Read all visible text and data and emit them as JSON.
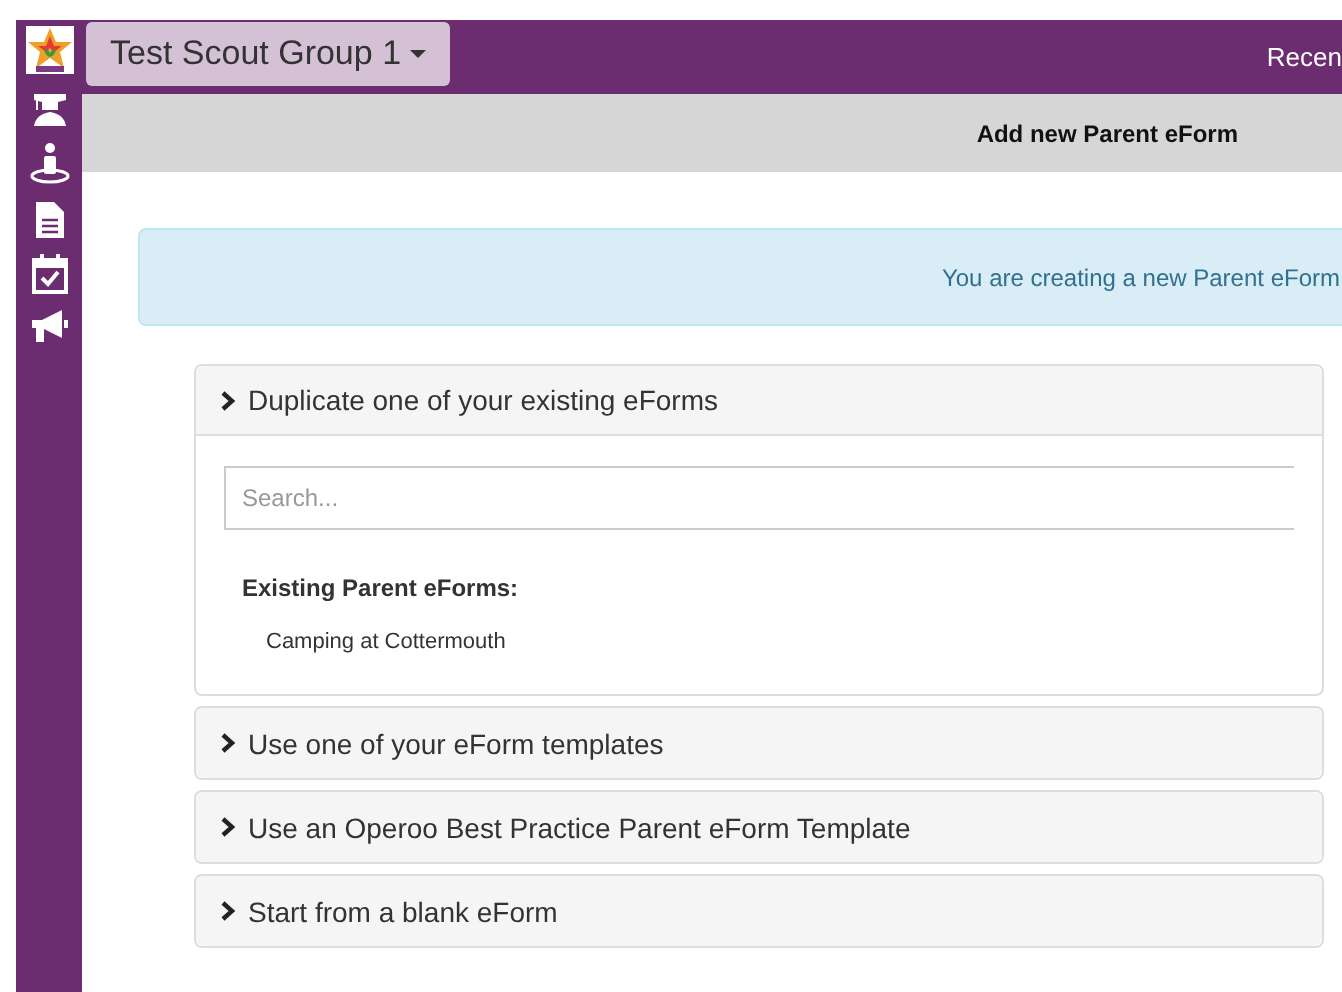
{
  "sidebar": {
    "items": [
      {
        "kind": "logo"
      },
      {
        "kind": "graduate"
      },
      {
        "kind": "person"
      },
      {
        "kind": "document"
      },
      {
        "kind": "calendar"
      },
      {
        "kind": "megaphone"
      }
    ]
  },
  "topbar": {
    "group_dropdown": "Test Scout Group 1",
    "right_link": "Recen"
  },
  "header": {
    "title": "Add new Parent eForm"
  },
  "alert": {
    "text": "You are creating a new Parent eForm"
  },
  "accordion": [
    {
      "title": "Duplicate one of your existing eForms",
      "expanded": true,
      "search": {
        "placeholder": "Search..."
      },
      "list_heading": "Existing Parent eForms:",
      "items": [
        "Camping at Cottermouth"
      ]
    },
    {
      "title": "Use one of your eForm templates",
      "expanded": false
    },
    {
      "title": "Use an Operoo Best Practice Parent eForm Template",
      "expanded": false
    },
    {
      "title": "Start from a blank eForm",
      "expanded": false
    }
  ]
}
